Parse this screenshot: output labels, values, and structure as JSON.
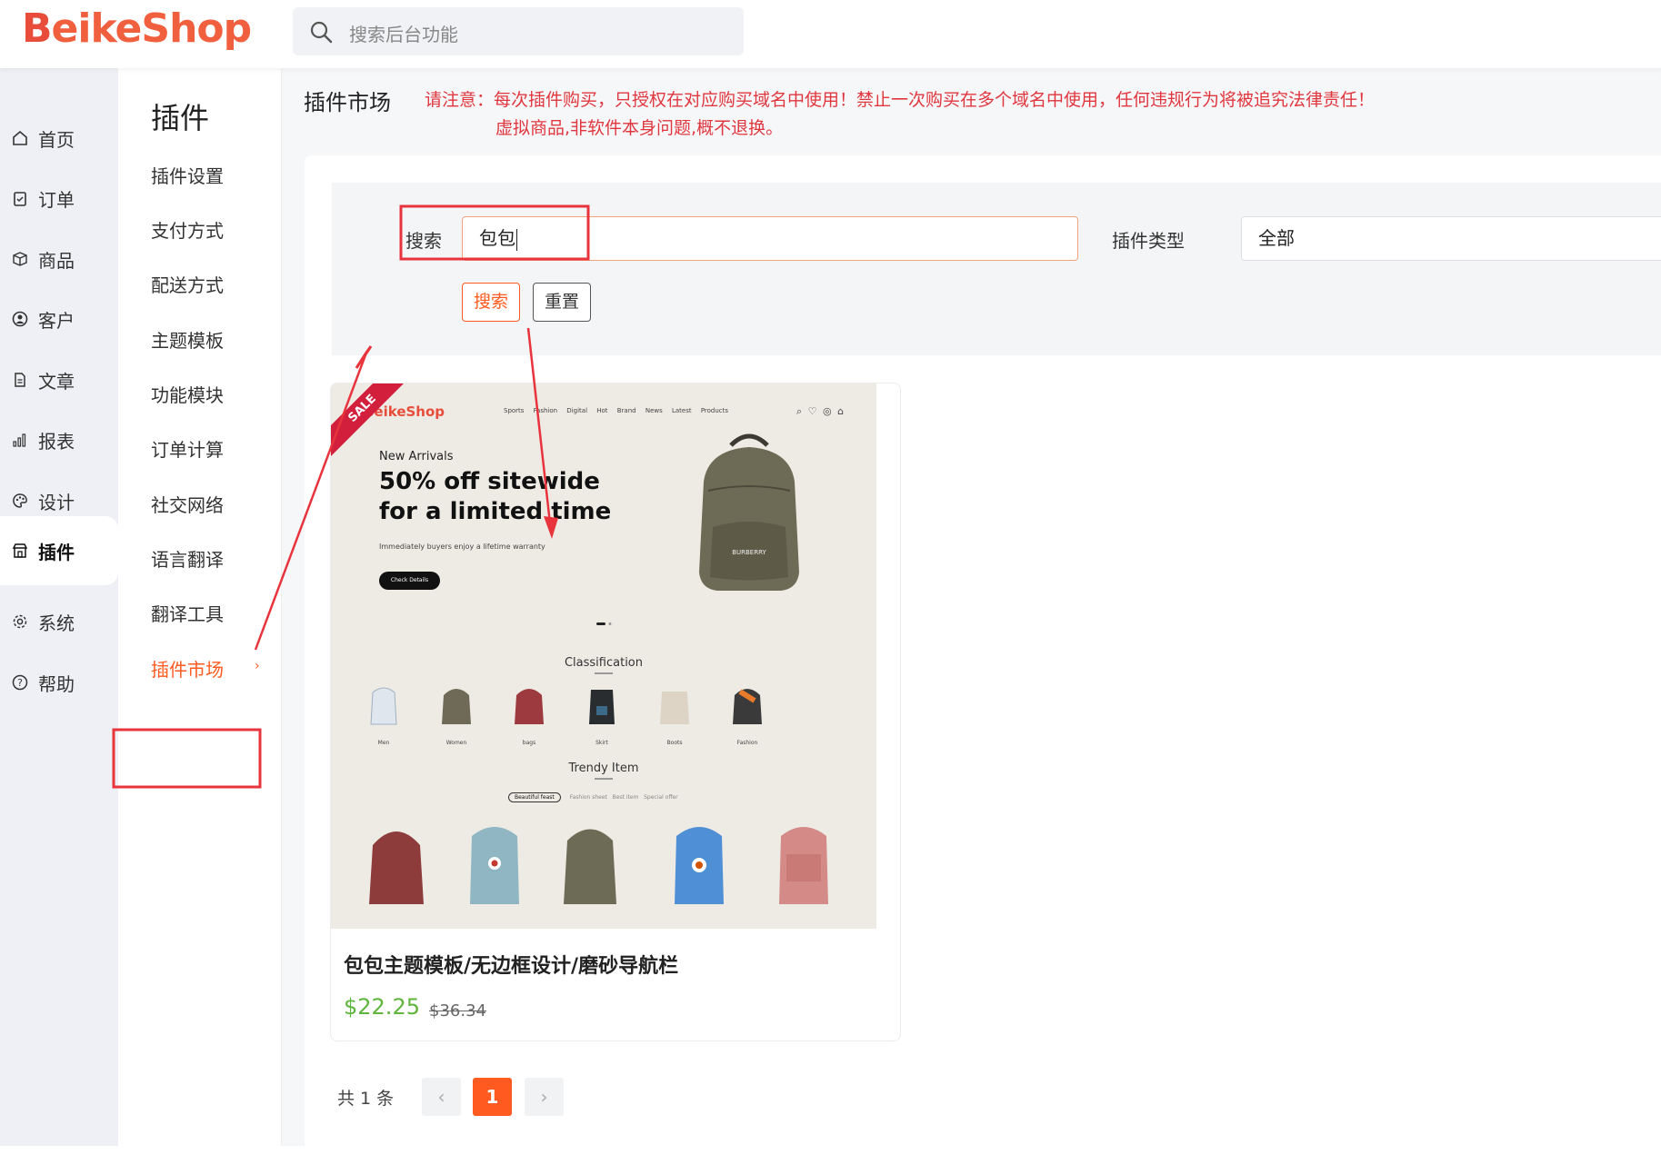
{
  "app": {
    "logo_b": "B",
    "logo_rest": "eikeShop"
  },
  "top_search": {
    "placeholder": "搜索后台功能"
  },
  "main_nav": [
    {
      "label": "首页",
      "icon": "home-icon"
    },
    {
      "label": "订单",
      "icon": "clipboard-icon"
    },
    {
      "label": "商品",
      "icon": "box-icon"
    },
    {
      "label": "客户",
      "icon": "user-icon"
    },
    {
      "label": "文章",
      "icon": "document-icon"
    },
    {
      "label": "报表",
      "icon": "bar-chart-icon"
    },
    {
      "label": "设计",
      "icon": "palette-icon"
    },
    {
      "label": "插件",
      "icon": "shop-icon",
      "active": true
    },
    {
      "label": "系统",
      "icon": "gear-icon"
    },
    {
      "label": "帮助",
      "icon": "help-icon"
    }
  ],
  "sub_nav": {
    "title": "插件",
    "items": [
      "插件设置",
      "支付方式",
      "配送方式",
      "主题模板",
      "功能模块",
      "订单计算",
      "社交网络",
      "语言翻译",
      "翻译工具",
      "插件市场"
    ],
    "active": "插件市场"
  },
  "page": {
    "title": "插件市场",
    "notice_line1": "请注意：每次插件购买，只授权在对应购买域名中使用！禁止一次购买在多个域名中使用，任何违规行为将被追究法律责任！",
    "notice_line2": "虚拟商品,非软件本身问题,概不退换。"
  },
  "filter": {
    "search_label": "搜索",
    "search_value": "包包",
    "type_label": "插件类型",
    "type_value": "全部",
    "search_button": "搜索",
    "reset_button": "重置"
  },
  "product": {
    "ribbon": "SALE",
    "title": "包包主题模板/无边框设计/磨砂导航栏",
    "price": "$22.25",
    "old_price": "$36.34",
    "preview": {
      "logo": "BeikeShop",
      "nav": "Sports Fashion Digital Hot Brand News Latest Products",
      "hero_sub": "New Arrivals",
      "hero_line1": "50% off sitewide",
      "hero_line2": "for a limited time",
      "hero_small": "Immediately buyers enjoy a lifetime warranty",
      "hero_button": "Check Details",
      "classification": "Classification",
      "categories": [
        "Men",
        "Women",
        "bags",
        "Skirt",
        "Boots",
        "Fashion"
      ],
      "trendy": "Trendy Item",
      "trendy_tabs": [
        "Beautiful feast",
        "Fashion sheet",
        "Best item",
        "Special offer"
      ]
    }
  },
  "pagination": {
    "total": "共 1 条",
    "prev": "‹",
    "current": "1",
    "next": "›"
  },
  "colors": {
    "accent": "#ff5a1f",
    "notice": "#e0373f",
    "price": "#5fb53d",
    "annotation": "#e8343c"
  }
}
